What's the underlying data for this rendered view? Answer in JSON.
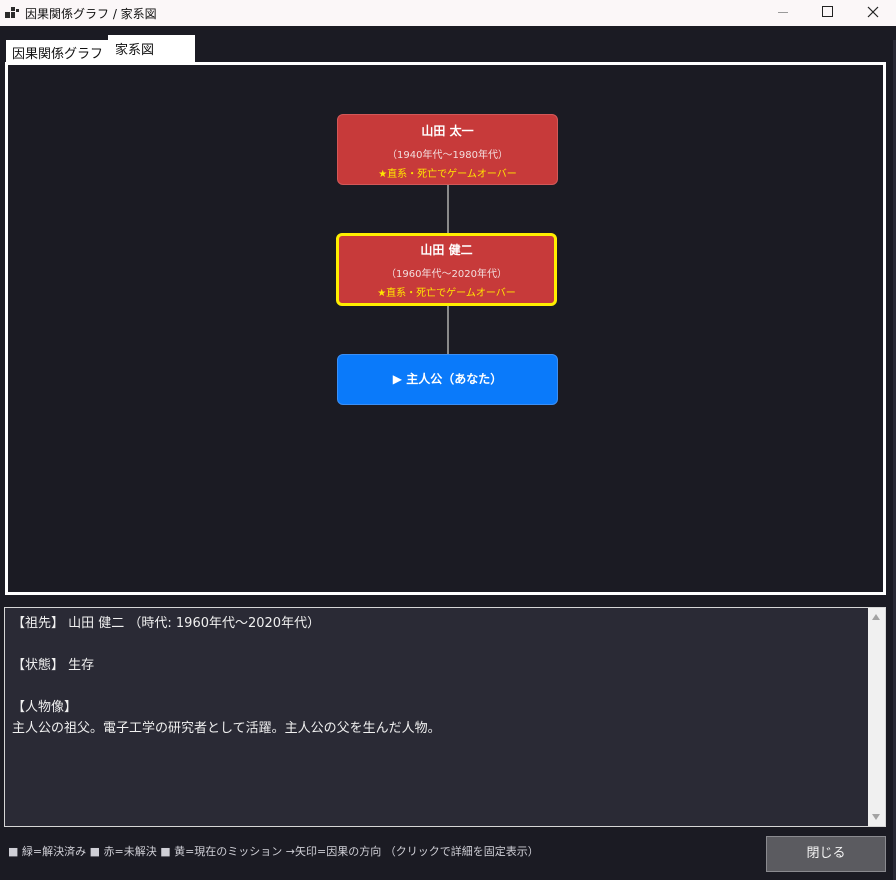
{
  "window": {
    "title": "因果関係グラフ / 家系図"
  },
  "tabs": [
    {
      "label": "因果関係グラフ",
      "selected": false
    },
    {
      "label": "家系図",
      "selected": true
    }
  ],
  "family_tree": {
    "nodes": [
      {
        "name": "山田 太一",
        "era": "（1940年代～1980年代）",
        "note": "★直系・死亡でゲームオーバー",
        "status": "ancestor"
      },
      {
        "name": "山田 健二",
        "era": "（1960年代～2020年代）",
        "note": "★直系・死亡でゲームオーバー",
        "status": "current"
      },
      {
        "name": "▶ 主人公（あなた）",
        "status": "player"
      }
    ]
  },
  "detail": {
    "lines": [
      "【祖先】 山田 健二 （時代: 1960年代～2020年代）",
      "",
      "【状態】 生存",
      "",
      "【人物像】",
      "主人公の祖父。電子工学の研究者として活躍。主人公の父を生んだ人物。"
    ]
  },
  "legend": {
    "text": "■ 緑=解決済み ■ 赤=未解決 ■ 黄=現在のミッション →矢印=因果の方向 （クリックで詳細を固定表示）"
  },
  "buttons": {
    "close_label": "閉じる"
  },
  "colors": {
    "background": "#1b1b23",
    "ancestor_node": "#c73a3a",
    "current_mission_border": "#ffee00",
    "player_node": "#0a7afa",
    "note_text": "#ffe600"
  }
}
